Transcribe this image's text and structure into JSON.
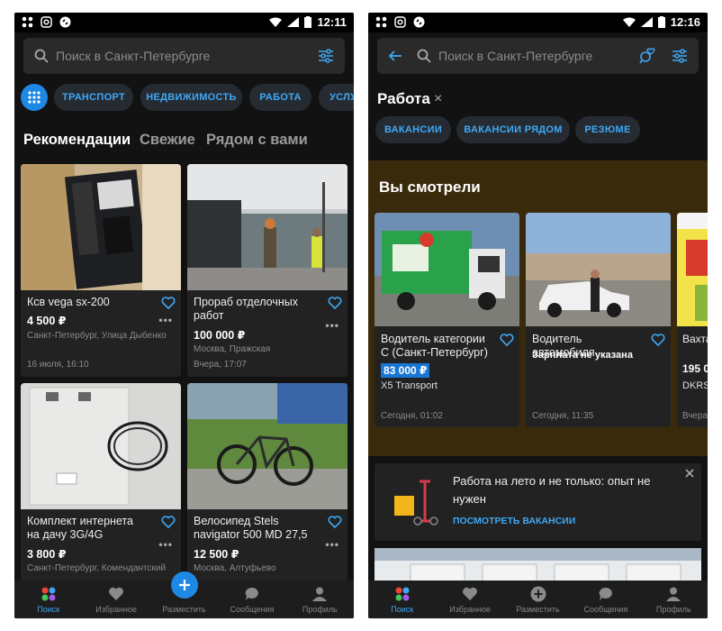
{
  "left": {
    "status": {
      "time": "12:11"
    },
    "search_placeholder": "Поиск в Санкт-Петербурге",
    "chips": [
      "ТРАНСПОРТ",
      "НЕДВИЖИМОСТЬ",
      "РАБОТА",
      "УСЛУ"
    ],
    "tabs": [
      "Рекомендации",
      "Свежие",
      "Рядом с вами"
    ],
    "cards": [
      {
        "title": "Ксв vega sx-200",
        "price": "4 500 ₽",
        "location": "Санкт-Петербург, Улица Дыбенко",
        "date": "16 июля, 16:10"
      },
      {
        "title": "Прораб отделочных работ",
        "price": "100 000 ₽",
        "location": "Москва, Пражская",
        "date": "Вчера, 17:07"
      },
      {
        "title": "Комплект интернета на дачу 3G/4G",
        "price": "3 800 ₽",
        "location": "Санкт-Петербург, Комендантский"
      },
      {
        "title": "Велосипед Stels navigator 500 MD 27,5",
        "price": "12 500 ₽",
        "location": "Москва, Алтуфьево"
      }
    ],
    "nav": [
      "Поиск",
      "Избранное",
      "Разместить",
      "Сообщения",
      "Профиль"
    ]
  },
  "right": {
    "status": {
      "time": "12:16"
    },
    "search_placeholder": "Поиск в Санкт-Петербурге",
    "category": "Работа",
    "close_glyph": "×",
    "chips": [
      "ВАКАНСИИ",
      "ВАКАНСИИ РЯДОМ",
      "РЕЗЮМЕ"
    ],
    "section_title": "Вы смотрели",
    "cards": [
      {
        "title": "Водитель категории С (Санкт-Петербург)",
        "salary": "83 000 ₽",
        "company": "X5 Transport",
        "date": "Сегодня, 01:02"
      },
      {
        "title": "Водитель автомобиля",
        "salary": "Зарплата не указана",
        "date": "Сегодня, 11:35"
      },
      {
        "title": "Вахта",
        "salary": "195 0",
        "company": "DKRS",
        "date": "Вчера"
      }
    ],
    "promo": {
      "text": "Работа на лето и не только: опыт не нужен",
      "link": "ПОСМОТРЕТЬ ВАКАНСИИ"
    },
    "nav": [
      "Поиск",
      "Избранное",
      "Разместить",
      "Сообщения",
      "Профиль"
    ]
  },
  "colors": {
    "accent": "#3ea8f5",
    "bg": "#121212",
    "card": "#222222",
    "brown": "#3a2a0c",
    "price_badge": "#1777d4"
  }
}
